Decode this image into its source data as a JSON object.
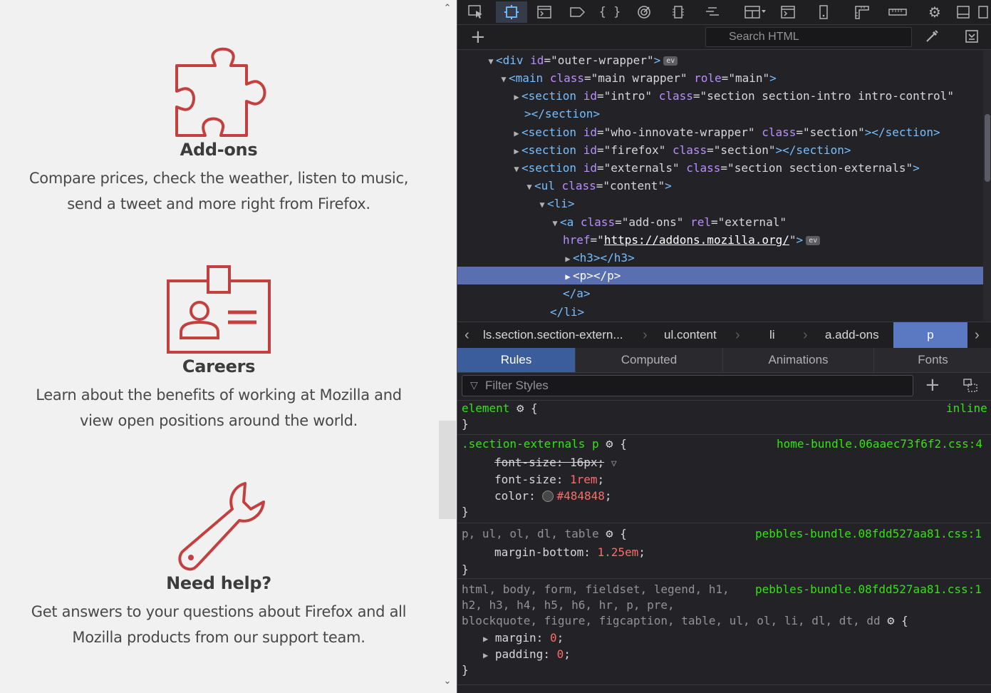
{
  "page": {
    "features": [
      {
        "icon": "puzzle-icon",
        "title": "Add-ons",
        "text": "Compare prices, check the weather, listen to music, send a tweet and more right from Firefox.",
        "line1": "Compare prices, check the weather, listen to music,",
        "line2": "send a tweet and more right from Firefox."
      },
      {
        "icon": "id-badge-icon",
        "title": "Careers",
        "text": "Learn about the benefits of working at Mozilla and view open positions around the world.",
        "line1": "Learn about the benefits of working at Mozilla and",
        "line2": "view open positions around the world."
      },
      {
        "icon": "wrench-icon",
        "title": "Need help?",
        "text": "Get answers to your questions about Firefox and all Mozilla products from our support team.",
        "line1": "Get answers to your questions about Firefox and all",
        "line2": "Mozilla products from our support team."
      }
    ],
    "accent_color": "#c4403f"
  },
  "devtools": {
    "toolbar": {
      "tools": [
        "element-picker-icon",
        "responsive-icon",
        "console-icon",
        "style-editor-icon",
        "debugger-icon",
        "performance-icon",
        "memory-icon",
        "network-icon",
        "layout-icon",
        "scratchpad-icon",
        "device-icon",
        "rulers-icon",
        "measure-icon",
        "settings-icon",
        "dock-icon"
      ]
    },
    "search": {
      "placeholder": "Search HTML"
    },
    "markup": {
      "l1": {
        "tag": "div",
        "id": "outer-wrapper"
      },
      "l2": {
        "tag": "main",
        "class": "main wrapper",
        "role": "main"
      },
      "l3": {
        "tag": "section",
        "id": "intro",
        "class": "section section-intro intro-control"
      },
      "l4": {
        "close": "></section>"
      },
      "l5": {
        "tag": "section",
        "id": "who-innovate-wrapper",
        "class": "section"
      },
      "l6": {
        "tag": "section",
        "id": "firefox",
        "class": "section"
      },
      "l7": {
        "tag": "section",
        "id": "externals",
        "class": "section section-externals"
      },
      "l8": {
        "tag": "ul",
        "class": "content"
      },
      "l9": {
        "tag": "li"
      },
      "l10": {
        "tag": "a",
        "class": "add-ons",
        "rel": "external"
      },
      "l11": {
        "href": "https://addons.mozilla.org/"
      },
      "l12": {
        "text": "<h3></h3>"
      },
      "l13": {
        "text": "<p></p>"
      },
      "l14": {
        "text": "</a>"
      },
      "l15": {
        "text": "</li>"
      },
      "ev_badge": "ev"
    },
    "breadcrumbs": [
      "ls.section.section-extern...",
      "ul.content",
      "li",
      "a.add-ons",
      "p"
    ],
    "tabs": [
      "Rules",
      "Computed",
      "Animations",
      "Fonts"
    ],
    "filter": {
      "placeholder": "Filter Styles"
    },
    "rules": [
      {
        "selector": "element",
        "source": "inline",
        "declarations": []
      },
      {
        "selector": ".section-externals p",
        "source": "home-bundle.06aaec73f6f2.css:4",
        "declarations": [
          {
            "prop": "font-size",
            "value": "16px",
            "overridden": true
          },
          {
            "prop": "font-size",
            "value": "1rem"
          },
          {
            "prop": "color",
            "value": "#484848"
          }
        ]
      },
      {
        "selector": "p, ul, ol, dl, table",
        "source": "pebbles-bundle.08fdd527aa81.css:1",
        "declarations": [
          {
            "prop": "margin-bottom",
            "value": "1.25em"
          }
        ]
      },
      {
        "selector_line1": "html, body, form, fieldset, legend, h1,",
        "selector_line2": "h2, h3, h4, h5, h6, hr, p, pre,",
        "selector_line3": "blockquote, figure, figcaption, table, ul, ol, li, dl, dt, dd",
        "source": "pebbles-bundle.08fdd527aa81.css:1",
        "declarations": [
          {
            "prop": "margin",
            "value": "0"
          },
          {
            "prop": "padding",
            "value": "0"
          }
        ]
      }
    ]
  }
}
